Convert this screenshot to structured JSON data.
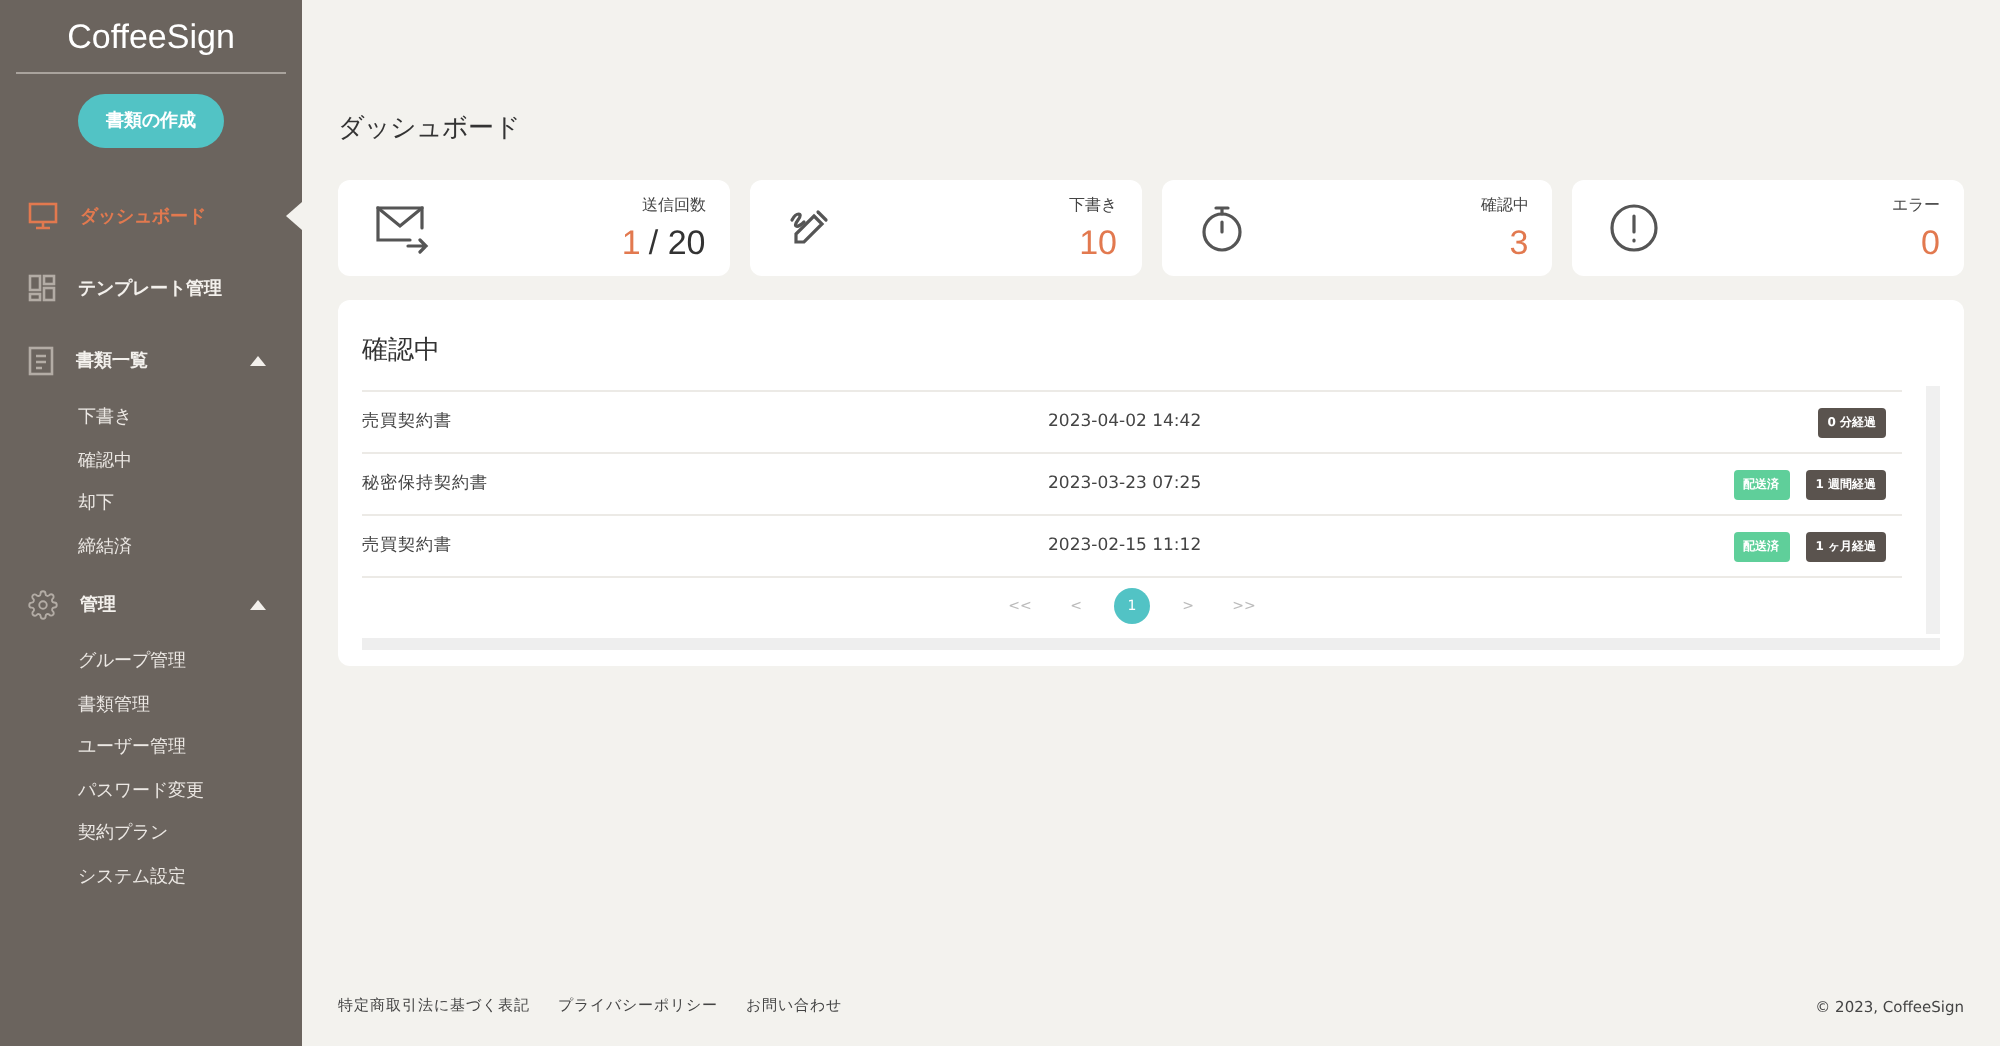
{
  "sidebar": {
    "brand": "CoffeeSign",
    "create_button": "書類の作成",
    "nav": [
      {
        "label": "ダッシュボード",
        "selected": true
      },
      {
        "label": "テンプレート管理",
        "selected": false
      },
      {
        "label": "書類一覧",
        "selected": false,
        "expanded": true,
        "children": [
          {
            "label": "下書き"
          },
          {
            "label": "確認中"
          },
          {
            "label": "却下"
          },
          {
            "label": "締結済"
          }
        ]
      },
      {
        "label": "管理",
        "selected": false,
        "expanded": true,
        "children": [
          {
            "label": "グループ管理"
          },
          {
            "label": "書類管理"
          },
          {
            "label": "ユーザー管理"
          },
          {
            "label": "パスワード変更"
          },
          {
            "label": "契約プラン"
          },
          {
            "label": "システム設定"
          }
        ]
      }
    ]
  },
  "page_title": "ダッシュボード",
  "stats": [
    {
      "label": "送信回数",
      "value": "1",
      "suffix": "/ 20"
    },
    {
      "label": "下書き",
      "value": "10"
    },
    {
      "label": "確認中",
      "value": "3"
    },
    {
      "label": "エラー",
      "value": "0"
    }
  ],
  "panel": {
    "title": "確認中",
    "rows": [
      {
        "name": "売買契約書",
        "date": "2023-04-02 14:42",
        "badges": [
          {
            "label": "0 分経過",
            "kind": "elapsed"
          }
        ]
      },
      {
        "name": "秘密保持契約書",
        "date": "2023-03-23 07:25",
        "badges": [
          {
            "label": "配送済",
            "kind": "delivered"
          },
          {
            "label": "1 週間経過",
            "kind": "elapsed"
          }
        ]
      },
      {
        "name": "売買契約書",
        "date": "2023-02-15 11:12",
        "badges": [
          {
            "label": "配送済",
            "kind": "delivered"
          },
          {
            "label": "1 ヶ月経過",
            "kind": "elapsed"
          }
        ]
      }
    ],
    "pagination": [
      {
        "label": "<<",
        "selected": false
      },
      {
        "label": "<",
        "selected": false
      },
      {
        "label": "1",
        "selected": true
      },
      {
        "label": ">",
        "selected": false
      },
      {
        "label": ">>",
        "selected": false
      }
    ]
  },
  "footer": {
    "links": [
      "特定商取引法に基づく表記",
      "プライバシーポリシー",
      "お問い合わせ"
    ],
    "copyright": "© 2023, CoffeeSign"
  }
}
